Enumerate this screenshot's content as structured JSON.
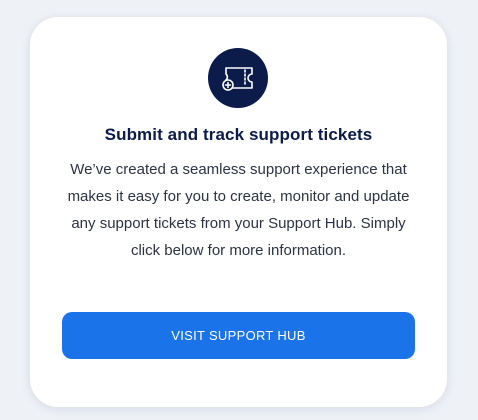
{
  "card": {
    "icon": "support-ticket-icon",
    "title": "Submit and track support tickets",
    "description": "We’ve created a seamless support experience that makes it easy for you to create, monitor and update any support tickets from your Support Hub. Simply click below for more information.",
    "button_label": "VISIT SUPPORT HUB"
  },
  "colors": {
    "icon_background": "#0b1b4a",
    "title": "#0b1b4a",
    "button": "#1a73e8"
  }
}
